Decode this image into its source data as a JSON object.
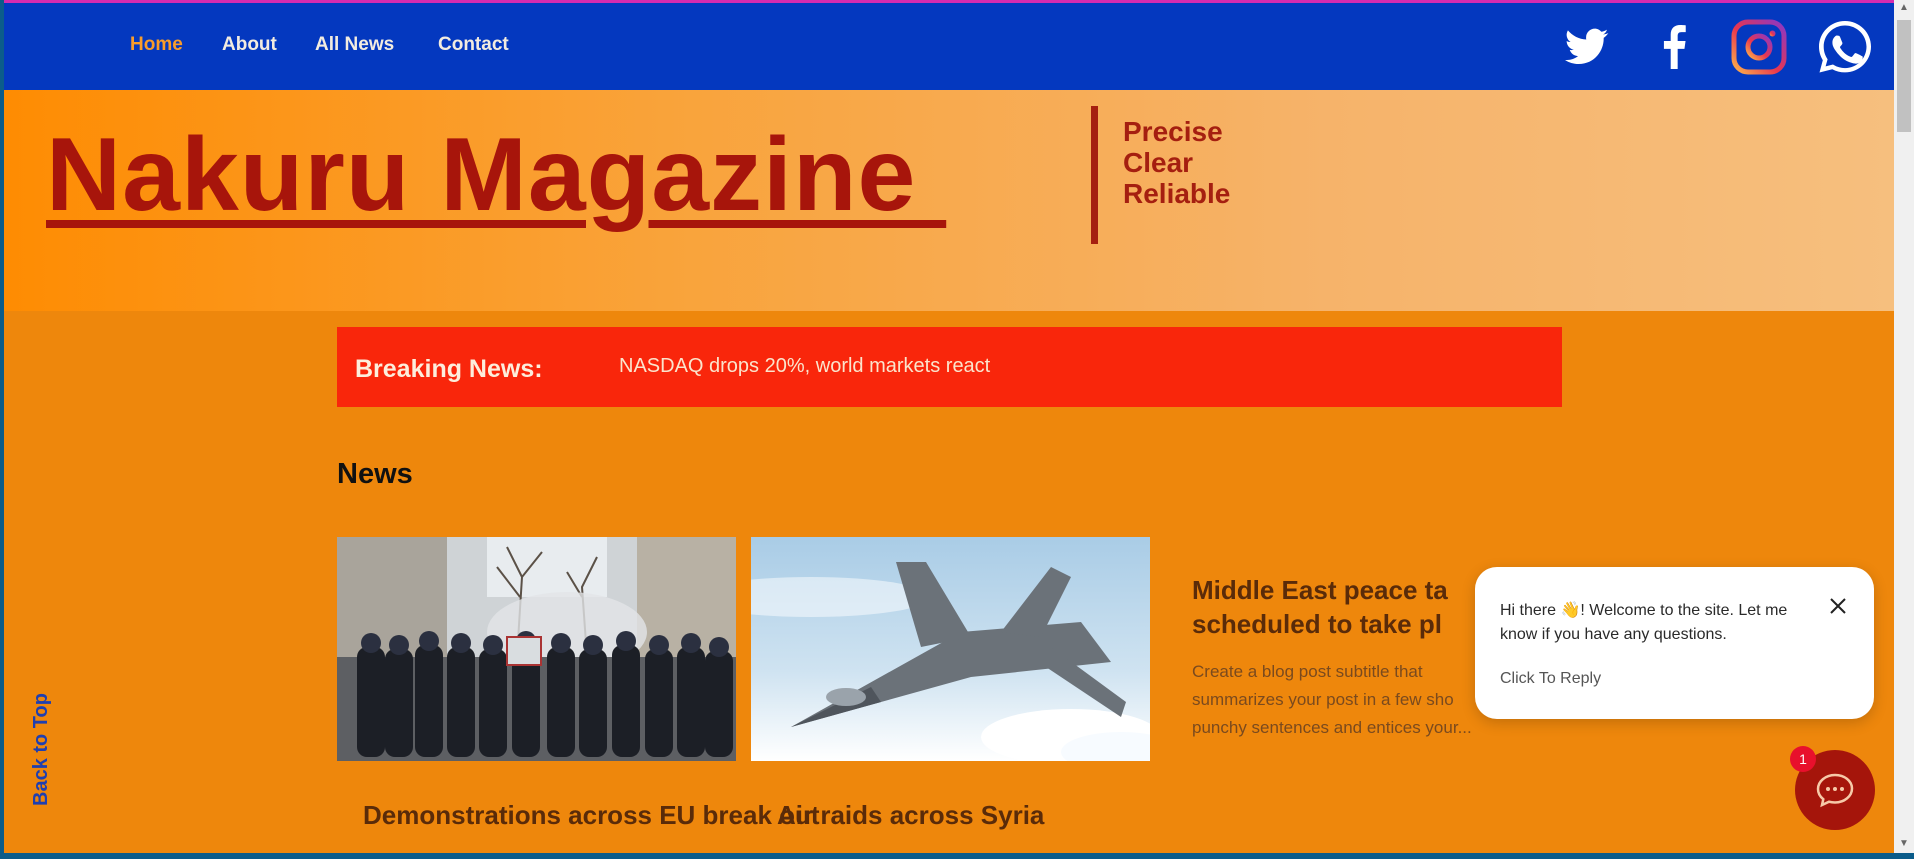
{
  "nav": {
    "items": [
      {
        "label": "Home",
        "active": true
      },
      {
        "label": "About"
      },
      {
        "label": "All News"
      },
      {
        "label": "Contact"
      }
    ],
    "social_icons": [
      "twitter-icon",
      "facebook-icon",
      "instagram-icon",
      "whatsapp-icon"
    ]
  },
  "hero": {
    "title": "Nakuru Magazine ",
    "tagline": [
      "Precise",
      "Clear",
      "Reliable"
    ]
  },
  "breaking": {
    "label": "Breaking News:",
    "text": "NASDAQ drops 20%, world markets react"
  },
  "news": {
    "heading": "News",
    "cards": [
      {
        "title": "Demonstrations across EU break out"
      },
      {
        "title": "Air raids across Syria"
      }
    ],
    "featured": {
      "title_line1": "Middle East peace ta",
      "title_line2": "scheduled to take pl",
      "subtitle": "Create a blog post subtitle that summarizes your post in a few sho punchy sentences and entices your..."
    }
  },
  "back_to_top": "Back to Top",
  "chat": {
    "message": "Hi there 👋! Welcome to the site. Let me know if you have any questions.",
    "reply": "Click To Reply",
    "badge": "1"
  },
  "colors": {
    "nav_bg": "#0438bf",
    "page_bg": "#ee870c",
    "brand_red": "#a7150b",
    "breaking_bg": "#f9260b"
  }
}
